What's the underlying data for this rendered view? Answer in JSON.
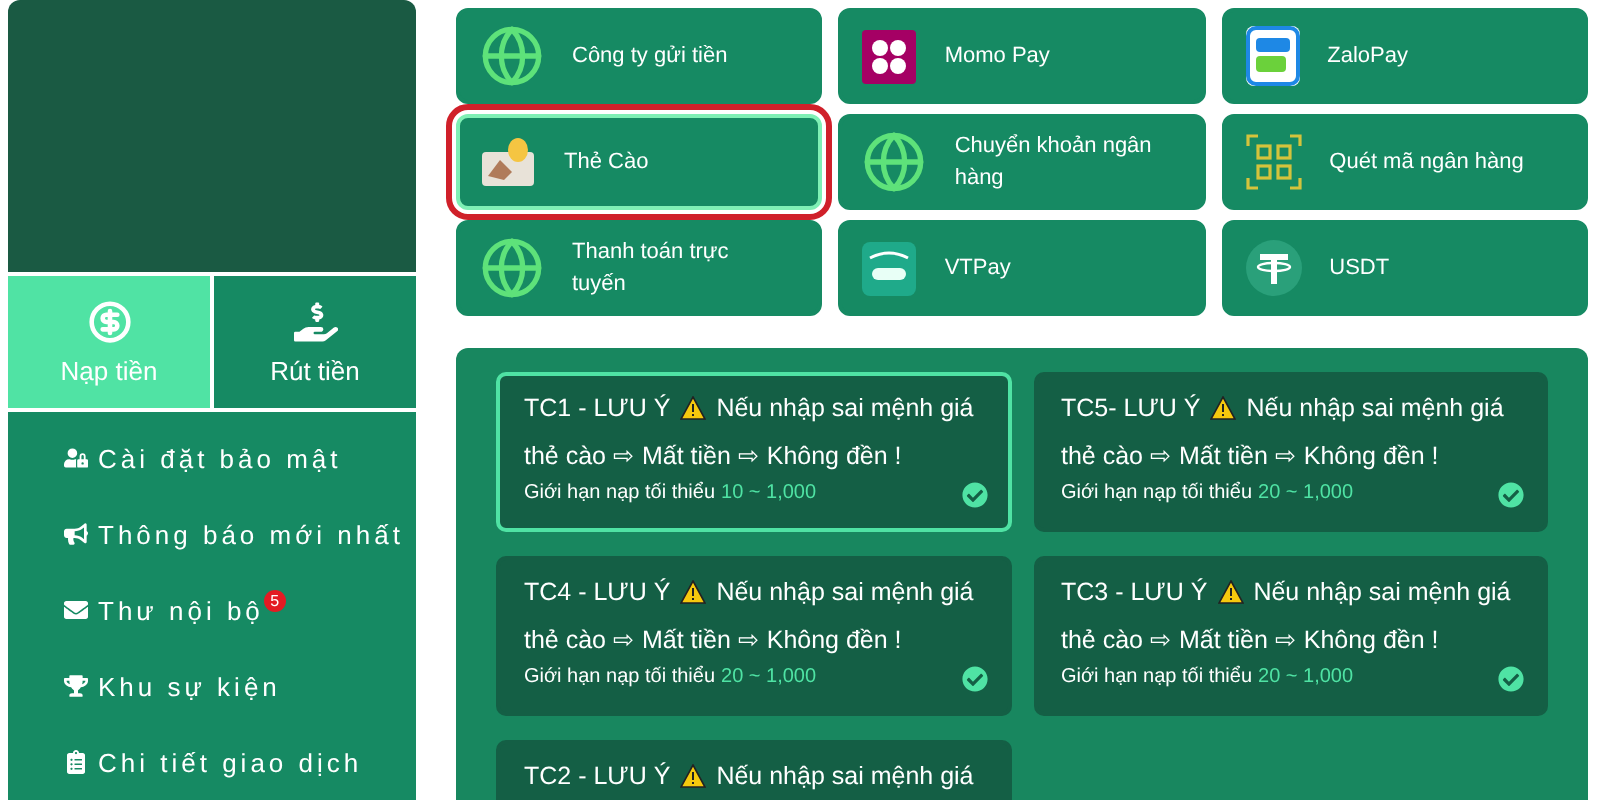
{
  "sidebar": {
    "tabs": [
      {
        "kind": "deposit",
        "label": "Nạp tiền",
        "selected": true
      },
      {
        "kind": "withdraw",
        "label": "Rút tiền",
        "selected": false
      }
    ],
    "menu": [
      {
        "kind": "security",
        "label": "Cài đặt bảo mật"
      },
      {
        "kind": "news",
        "label": "Thông báo mới nhất"
      },
      {
        "kind": "mail",
        "label": "Thư nội bộ",
        "badge": "5"
      },
      {
        "kind": "events",
        "label": "Khu sự kiện"
      },
      {
        "kind": "history",
        "label": "Chi tiết giao dịch"
      }
    ]
  },
  "methods": [
    {
      "kind": "globe",
      "label": "Công ty gửi tiền",
      "selected": false
    },
    {
      "kind": "momo",
      "label": "Momo Pay",
      "selected": false
    },
    {
      "kind": "zalo",
      "label": "ZaloPay",
      "selected": false
    },
    {
      "kind": "card",
      "label": "Thẻ Cào",
      "selected": true
    },
    {
      "kind": "globe",
      "label": "Chuyển khoản ngân hàng",
      "selected": false
    },
    {
      "kind": "qr",
      "label": "Quét mã ngân hàng",
      "selected": false
    },
    {
      "kind": "globe",
      "label": "Thanh toán trực tuyến",
      "selected": false
    },
    {
      "kind": "vtpay",
      "label": "VTPay",
      "selected": false
    },
    {
      "kind": "usdt",
      "label": "USDT",
      "selected": false
    }
  ],
  "channels": [
    {
      "title": "TC1 - LƯU Ý",
      "message": "Nếu nhập sai mệnh giá",
      "message_line2": "thẻ cào ⇨ Mất tiền ⇨ Không đền !",
      "limit_label": "Giới hạn nạp tối thiểu",
      "limit_range": "10 ~ 1,000",
      "selected": true
    },
    {
      "title": "TC5- LƯU Ý",
      "message": "Nếu nhập sai mệnh giá",
      "message_line2": "thẻ cào ⇨ Mất tiền ⇨ Không đền !",
      "limit_label": "Giới hạn nạp tối thiểu",
      "limit_range": "20 ~ 1,000",
      "selected": false
    },
    {
      "title": "TC4 - LƯU Ý",
      "message": "Nếu nhập sai mệnh giá",
      "message_line2": "thẻ cào ⇨ Mất tiền ⇨ Không đền !",
      "limit_label": "Giới hạn nạp tối thiểu",
      "limit_range": "20 ~ 1,000",
      "selected": false
    },
    {
      "title": "TC3 - LƯU Ý",
      "message": "Nếu nhập sai mệnh giá",
      "message_line2": "thẻ cào ⇨ Mất tiền ⇨ Không đền !",
      "limit_label": "Giới hạn nạp tối thiểu",
      "limit_range": "20 ~ 1,000",
      "selected": false
    },
    {
      "title": "TC2 - LƯU Ý",
      "message": "Nếu nhập sai mệnh giá",
      "selected": false
    }
  ]
}
